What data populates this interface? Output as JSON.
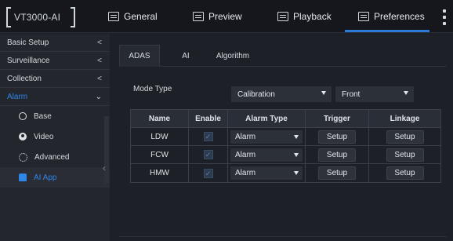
{
  "header": {
    "logo_text": "VT3000-AI",
    "nav": [
      {
        "label": "General",
        "icon": "general-icon"
      },
      {
        "label": "Preview",
        "icon": "preview-icon"
      },
      {
        "label": "Playback",
        "icon": "playback-icon"
      },
      {
        "label": "Preferences",
        "icon": "preferences-icon",
        "active": true
      }
    ],
    "accent_color": "#2c7ad6"
  },
  "sidebar": {
    "items": [
      {
        "label": "Basic Setup",
        "chevron": "<"
      },
      {
        "label": "Surveillance",
        "chevron": "<"
      },
      {
        "label": "Collection",
        "chevron": "<"
      },
      {
        "label": "Alarm",
        "chevron": "⌄",
        "active": true
      }
    ],
    "subitems": [
      {
        "label": "Base",
        "icon": "circle-icon"
      },
      {
        "label": "Video",
        "icon": "video-icon"
      },
      {
        "label": "Advanced",
        "icon": "advanced-icon"
      },
      {
        "label": "AI App",
        "icon": "ai-app-icon",
        "selected": true
      }
    ]
  },
  "main": {
    "tabs": [
      {
        "label": "ADAS",
        "active": true
      },
      {
        "label": "AI"
      },
      {
        "label": "Algorithm"
      }
    ],
    "mode_label": "Mode Type",
    "mode_select": "Calibration",
    "position_select": "Front",
    "table": {
      "headers": [
        "Name",
        "Enable",
        "Alarm Type",
        "Trigger",
        "Linkage"
      ],
      "rows": [
        {
          "name": "LDW",
          "enabled": true,
          "alarm_type": "Alarm",
          "trigger": "Setup",
          "linkage": "Setup"
        },
        {
          "name": "FCW",
          "enabled": true,
          "alarm_type": "Alarm",
          "trigger": "Setup",
          "linkage": "Setup"
        },
        {
          "name": "HMW",
          "enabled": true,
          "alarm_type": "Alarm",
          "trigger": "Setup",
          "linkage": "Setup"
        }
      ]
    }
  }
}
